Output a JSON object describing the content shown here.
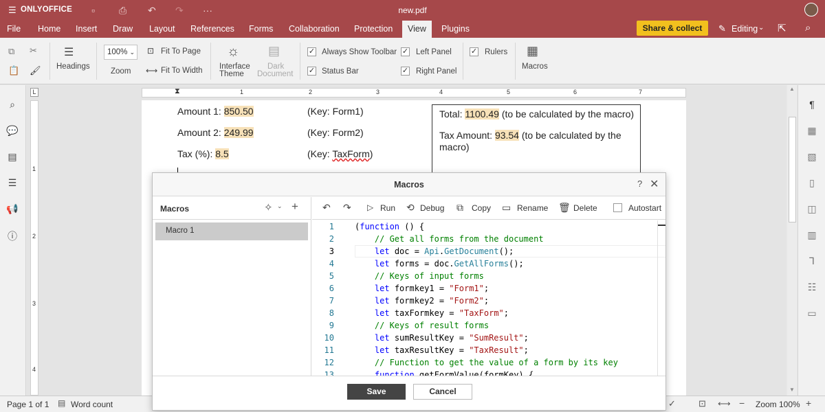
{
  "titlebar": {
    "app_name": "ONLYOFFICE",
    "doc_name": "new.pdf"
  },
  "menu": {
    "tabs": [
      "File",
      "Home",
      "Insert",
      "Draw",
      "Layout",
      "References",
      "Forms",
      "Collaboration",
      "Protection",
      "View",
      "Plugins"
    ],
    "share_label": "Share & collect",
    "editing_label": "Editing"
  },
  "ribbon": {
    "headings": "Headings",
    "zoom_value": "100%",
    "zoom_label": "Zoom",
    "fit_page": "Fit To Page",
    "fit_width": "Fit To Width",
    "interface_theme_1": "Interface",
    "interface_theme_2": "Theme",
    "dark_doc_1": "Dark",
    "dark_doc_2": "Document",
    "always_toolbar": "Always Show Toolbar",
    "status_bar": "Status Bar",
    "left_panel": "Left Panel",
    "right_panel": "Right Panel",
    "rulers": "Rulers",
    "macros": "Macros"
  },
  "ruler_marks": [
    "1",
    "2",
    "3",
    "4",
    "5",
    "6",
    "7"
  ],
  "vruler_marks": [
    "1",
    "2",
    "3",
    "4"
  ],
  "document": {
    "amount1_label": "Amount 1:",
    "amount1_value": "850.50",
    "amount1_key": "(Key: Form1)",
    "amount2_label": "Amount 2:",
    "amount2_value": "249.99",
    "amount2_key": "(Key: Form2)",
    "tax_label": "Tax (%):",
    "tax_value": "8.5",
    "tax_key_prefix": "(Key: ",
    "tax_key": "TaxForm",
    "tax_key_suffix": ")",
    "total_label": "Total:",
    "total_value": "1100.49",
    "total_note": "(to be calculated by the macro)",
    "taxamt_label": "Tax Amount:",
    "taxamt_value": "93.54",
    "taxamt_note_1": "(to be calculated by the",
    "taxamt_note_2": "macro)"
  },
  "statusbar": {
    "page": "Page 1 of 1",
    "word_count": "Word count",
    "zoom": "Zoom 100%"
  },
  "dialog": {
    "title": "Macros",
    "help": "?",
    "panel_title": "Macros",
    "macros": [
      "Macro 1"
    ],
    "toolbar": {
      "run": "Run",
      "debug": "Debug",
      "copy": "Copy",
      "rename": "Rename",
      "delete": "Delete",
      "autostart": "Autostart"
    },
    "code_lines": [
      {
        "n": "1",
        "html": "(<span class='kw'>function</span> () {"
      },
      {
        "n": "2",
        "html": "    <span class='cm'>// Get all forms from the document</span>"
      },
      {
        "n": "3",
        "html": "    <span class='kw'>let</span> doc = <span class='fn'>Api</span>.<span class='fn'>GetDocument</span>();"
      },
      {
        "n": "4",
        "html": "    <span class='kw'>let</span> forms = doc.<span class='fn'>GetAllForms</span>();"
      },
      {
        "n": "5",
        "html": "    <span class='cm'>// Keys of input forms</span>"
      },
      {
        "n": "6",
        "html": "    <span class='kw'>let</span> formkey1 = <span class='st'>\"Form1\"</span>;"
      },
      {
        "n": "7",
        "html": "    <span class='kw'>let</span> formkey2 = <span class='st'>\"Form2\"</span>;"
      },
      {
        "n": "8",
        "html": "    <span class='kw'>let</span> taxFormkey = <span class='st'>\"TaxForm\"</span>;"
      },
      {
        "n": "9",
        "html": "    <span class='cm'>// Keys of result forms</span>"
      },
      {
        "n": "10",
        "html": "    <span class='kw'>let</span> sumResultKey = <span class='st'>\"SumResult\"</span>;"
      },
      {
        "n": "11",
        "html": "    <span class='kw'>let</span> taxResultKey = <span class='st'>\"TaxResult\"</span>;"
      },
      {
        "n": "12",
        "html": "    <span class='cm'>// Function to get the value of a form by its key</span>"
      },
      {
        "n": "13",
        "html": "    <span class='kw'>function</span> getFormValue(formKey) {"
      }
    ],
    "save": "Save",
    "cancel": "Cancel"
  },
  "colors": {
    "accent": "#a6484a",
    "share": "#f2c01e"
  }
}
